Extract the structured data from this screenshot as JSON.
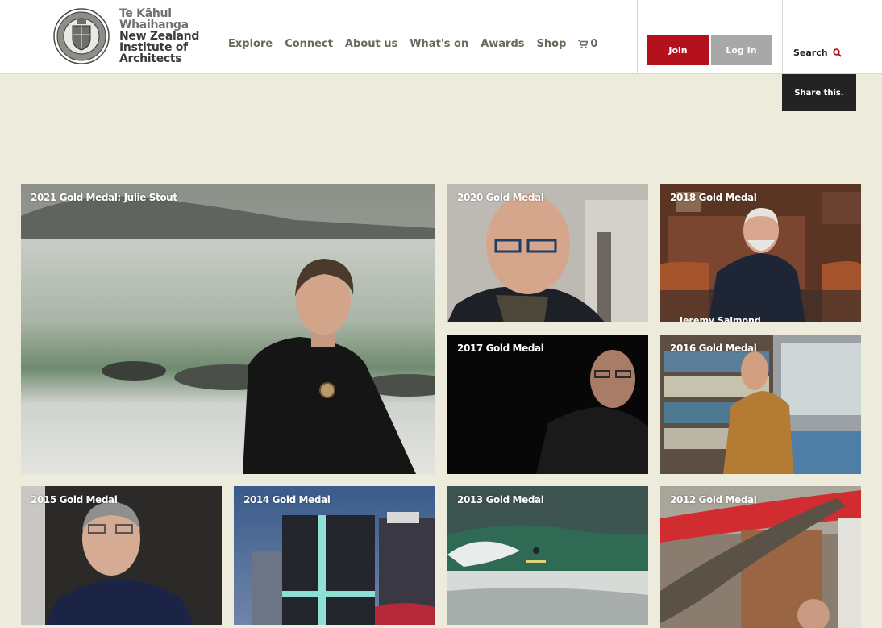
{
  "brand": {
    "line1": "Te Kāhui",
    "line2": "Whaihanga",
    "line3": "New Zealand",
    "line4": "Institute of",
    "line5": "Architects"
  },
  "nav": {
    "items": [
      "Explore",
      "Connect",
      "About us",
      "What's on",
      "Awards",
      "Shop"
    ],
    "cart_count": "0"
  },
  "actions": {
    "join": "Join",
    "login": "Log In",
    "search": "Search",
    "share": "Share this."
  },
  "tiles": [
    {
      "caption": "2021 Gold Medal: Julie Stout"
    },
    {
      "caption": "2020 Gold Medal"
    },
    {
      "caption": "2018 Gold Medal",
      "sub": "Jeremy Salmond"
    },
    {
      "caption": "2017 Gold Medal"
    },
    {
      "caption": "2016 Gold Medal"
    },
    {
      "caption": "2015 Gold Medal"
    },
    {
      "caption": "2014 Gold Medal"
    },
    {
      "caption": "2013 Gold Medal"
    },
    {
      "caption": "2012 Gold Medal"
    }
  ],
  "icons": [
    "seal-logo-icon",
    "cart-icon",
    "search-icon"
  ],
  "colors": {
    "join": "#b4111c",
    "login": "#a8a8a8",
    "share": "#232323",
    "background": "#ecebdc"
  }
}
